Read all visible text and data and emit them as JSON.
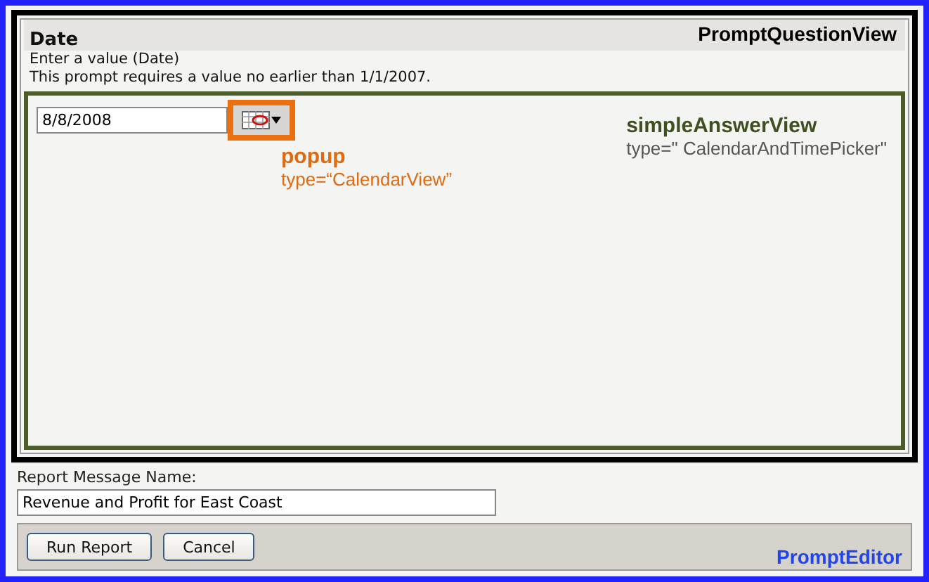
{
  "question": {
    "title": "Date",
    "annotation": "PromptQuestionView",
    "instruction": "Enter a value (Date)",
    "constraint": "This prompt requires a value no earlier than 1/1/2007."
  },
  "answer": {
    "value": "8/8/2008",
    "annotation": "simpleAnswerView",
    "annotation_type": "type=\" CalendarAndTimePicker\"",
    "popup_label": "popup",
    "popup_type": "type=“CalendarView”"
  },
  "report_name": {
    "label": "Report Message Name:",
    "value": "Revenue and Profit for East Coast"
  },
  "buttons": [
    "Run Report",
    "Cancel"
  ],
  "editor_annotation": "PromptEditor"
}
